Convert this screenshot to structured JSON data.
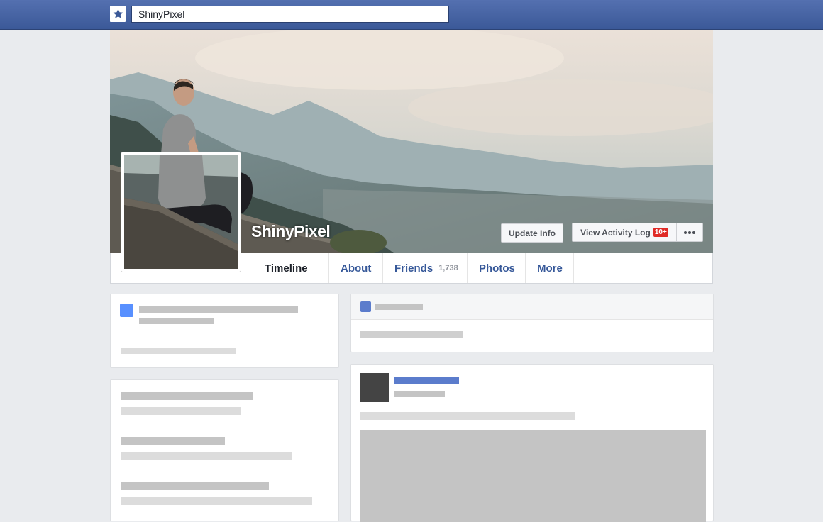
{
  "search": {
    "value": "ShinyPixel",
    "logo_icon": "star-icon"
  },
  "profile": {
    "name": "ShinyPixel",
    "update_info_label": "Update Info",
    "activity_log_label": "View Activity Log",
    "activity_badge": "10+",
    "more_options_icon": "ellipsis-icon"
  },
  "tabs": [
    {
      "label": "Timeline",
      "active": true
    },
    {
      "label": "About",
      "active": false
    },
    {
      "label": "Friends",
      "count": "1,738",
      "active": false
    },
    {
      "label": "Photos",
      "active": false
    },
    {
      "label": "More",
      "active": false
    }
  ],
  "colors": {
    "topbar": "#3b5998",
    "page_background": "#e9ebee",
    "link": "#365899",
    "badge": "#e02b27",
    "placeholder_blue": "#5890ff"
  }
}
